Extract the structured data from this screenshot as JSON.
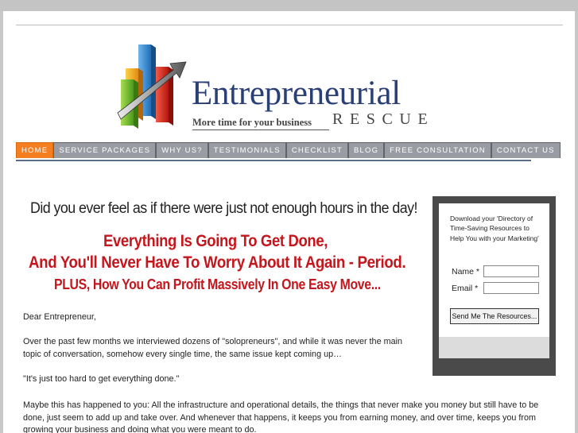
{
  "brand": {
    "name": "Entrepreneurial",
    "tagline": "More time for your business",
    "rescue": "RESCUE"
  },
  "nav": {
    "items": [
      {
        "label": "HOME",
        "active": true
      },
      {
        "label": "SERVICE PACKAGES",
        "active": false
      },
      {
        "label": "WHY US?",
        "active": false
      },
      {
        "label": "TESTIMONIALS",
        "active": false
      },
      {
        "label": "CHECKLIST",
        "active": false
      },
      {
        "label": "BLOG",
        "active": false
      },
      {
        "label": "FREE CONSULTATION",
        "active": false
      },
      {
        "label": "CONTACT US",
        "active": false
      }
    ]
  },
  "hero": {
    "headline": "Did you ever feel as if there were just not enough hours in the day!",
    "red_line1": "Everything Is Going To Get Done,",
    "red_line2": "And You'll Never Have To Worry About It Again - Period.",
    "red_line3": "PLUS, How You Can Profit Massively In One Easy Move..."
  },
  "body": {
    "greeting": "Dear Entrepreneur,",
    "para1": "Over the past few months we interviewed dozens of \"solopreneurs\", and while it was never the main topic of conversation, somehow every single time, the same issue kept coming up…",
    "quote": "\"It's just too hard to get everything done.\"",
    "para2": "Maybe this has happened to you: All the infrastructure and operational details, the things that never make you money but still have to be done, just seem to add up and take over. And whenever that happens, it keeps you from earning money, and over time, keeps you from growing your business and doing what you were meant to do."
  },
  "sidebar": {
    "description": "Download your 'Directory of Time-Saving Resources to Help You with your Marketing'",
    "name_label": "Name *",
    "email_label": "Email *",
    "name_value": "",
    "email_value": "",
    "button_label": "Send Me The Resources..."
  },
  "colors": {
    "nav_active": "#f57f20",
    "nav_inactive": "#999da3",
    "brand_blue": "#2b3f77",
    "headline_red": "#c4161c"
  }
}
